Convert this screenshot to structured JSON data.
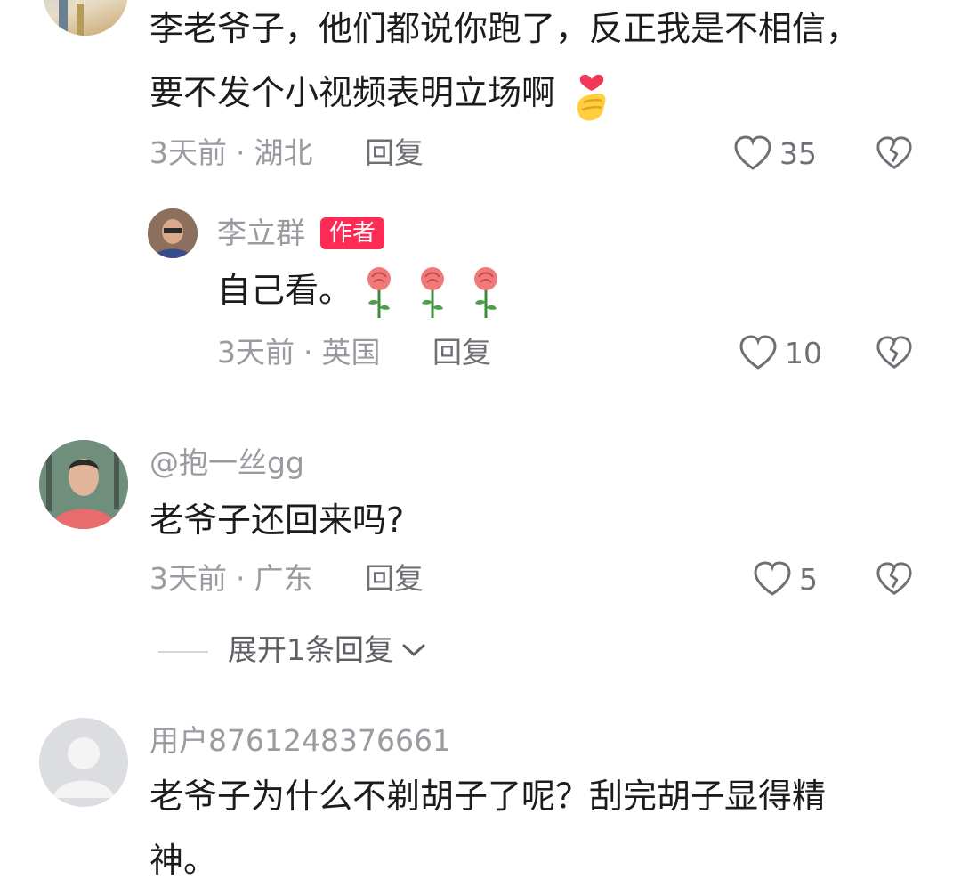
{
  "colors": {
    "author_badge": "#fe2c55",
    "meta_gray": "#9a9ba0",
    "text": "#1c1c1c"
  },
  "comments": [
    {
      "text_line1": "李老爷子，他们都说你跑了，反正我是不相信，",
      "text_line2": "要不发个小视频表明立场啊",
      "emoji": "finger-heart",
      "time": "3天前",
      "location": "湖北",
      "reply_label": "回复",
      "likes": "35"
    },
    {
      "is_reply": true,
      "username": "李立群",
      "badge": "作者",
      "text": "自己看。",
      "emoji": "rose",
      "time": "3天前",
      "location": "英国",
      "reply_label": "回复",
      "likes": "10"
    },
    {
      "username": "@抱一丝gg",
      "text": "老爷子还回来吗?",
      "time": "3天前",
      "location": "广东",
      "reply_label": "回复",
      "likes": "5",
      "expand_label": "展开1条回复"
    },
    {
      "username": "用户8761248376661",
      "text_line1": "老爷子为什么不剃胡子了呢？刮完胡子显得精",
      "text_line2": "神。"
    }
  ]
}
